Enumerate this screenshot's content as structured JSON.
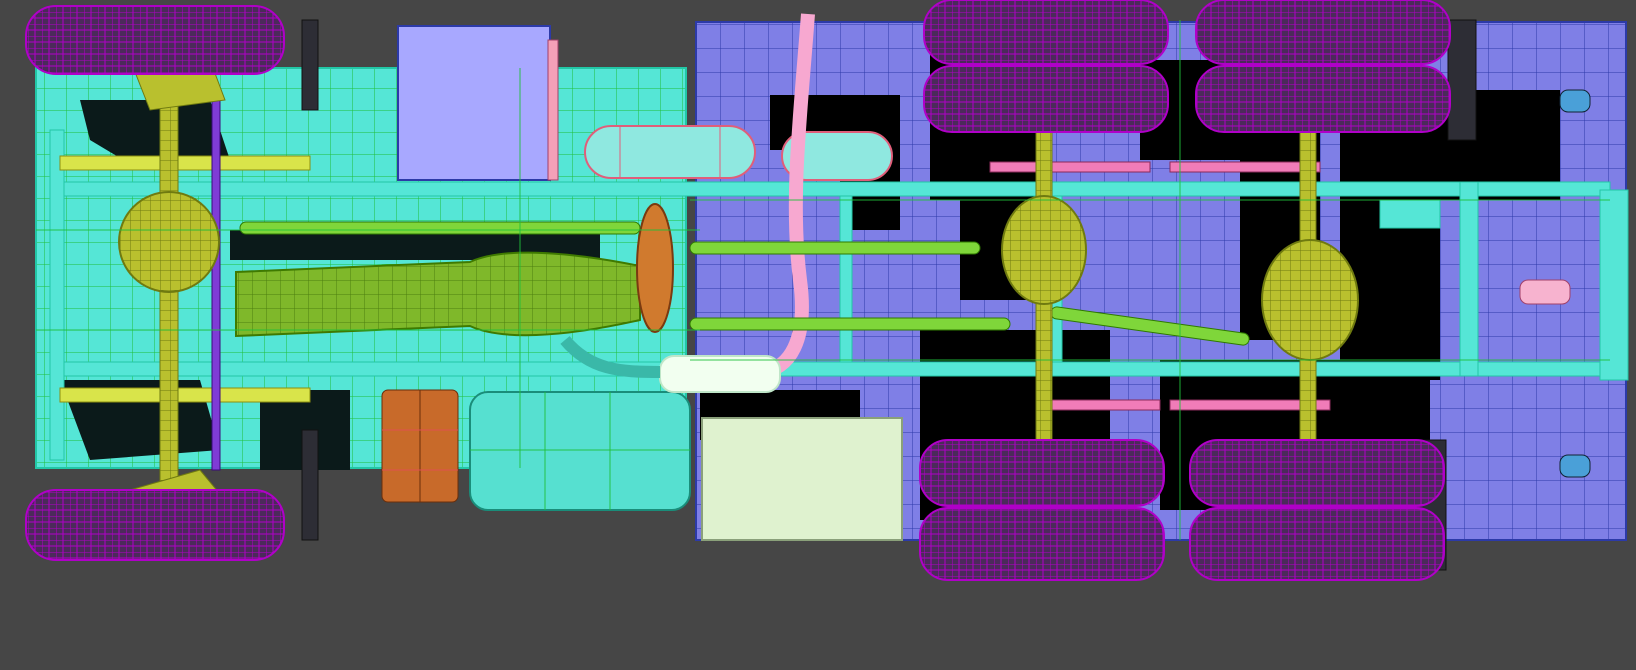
{
  "viewport": {
    "background": "#464646",
    "render_mode": "wireframe-over-shaded",
    "view": "bottom"
  },
  "palette": {
    "frame": "#55e6d6",
    "frame_edge": "#22c7a6",
    "wire": "#1fbf3a",
    "body_panel": "#7f7fe6",
    "body_panel_edge": "#2c3aa8",
    "tire": "#4b2a5a",
    "tire_wire": "#b000c8",
    "axle": "#b9c02e",
    "driveshaft": "#7fd63a",
    "gearbox": "#7fb82a",
    "brake_drum": "#d07a2e",
    "tank": "#56e0d0",
    "air_tank": "#8fe8e0",
    "exhaust": "#f5b6d6",
    "exhaust_pipe": "#f7a8d0",
    "battery": "#c86a2a",
    "toolbox": "#dff2cf",
    "leaf_spring": "#d9e44a",
    "linkage": "#f07cb8",
    "steering": "#7f3cd6",
    "shadow": "#000000"
  },
  "objects": [
    {
      "name": "chassis-frame",
      "icon": "frame-rail-icon"
    },
    {
      "name": "front-axle",
      "icon": "axle-icon"
    },
    {
      "name": "rear-axle-1",
      "icon": "axle-icon"
    },
    {
      "name": "rear-axle-2",
      "icon": "axle-icon"
    },
    {
      "name": "front-tires",
      "icon": "tire-icon"
    },
    {
      "name": "rear-tires",
      "icon": "tire-icon"
    },
    {
      "name": "gearbox",
      "icon": "gearbox-icon"
    },
    {
      "name": "fuel-tank",
      "icon": "tank-icon"
    },
    {
      "name": "air-tank",
      "icon": "tank-icon"
    },
    {
      "name": "muffler",
      "icon": "exhaust-icon"
    },
    {
      "name": "battery-box",
      "icon": "battery-icon"
    },
    {
      "name": "toolbox",
      "icon": "box-icon"
    },
    {
      "name": "cargo-bed",
      "icon": "panel-icon"
    }
  ]
}
